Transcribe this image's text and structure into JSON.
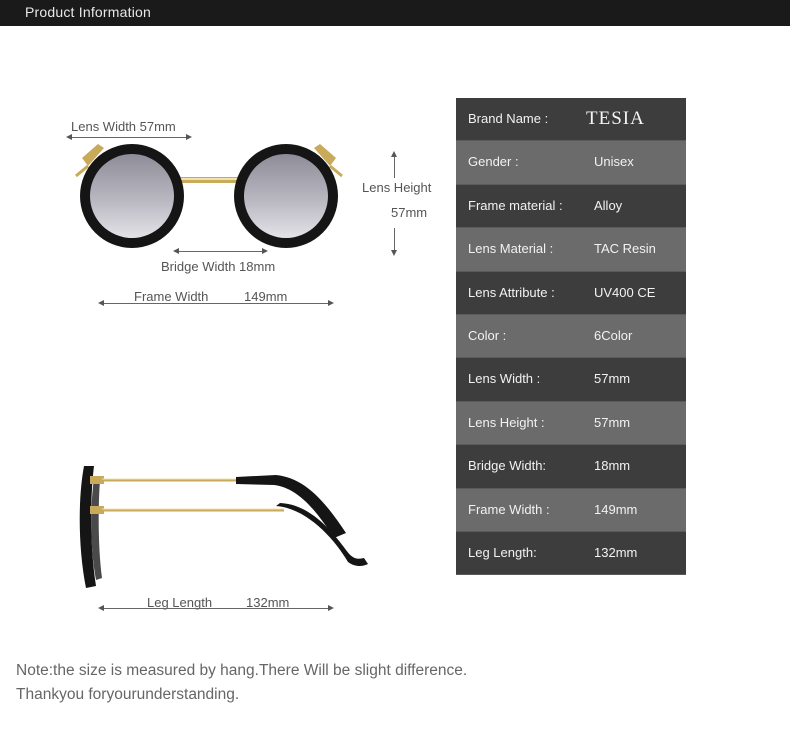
{
  "header": {
    "title": "Product Information"
  },
  "front_view": {
    "lens_width_label": "Lens  Width  57mm",
    "lens_height_label": "Lens Height",
    "lens_height_value": "57mm",
    "bridge_width_label": "Bridge  Width  18mm",
    "frame_width_label": "Frame    Width",
    "frame_width_value": "149mm"
  },
  "side_view": {
    "leg_length_label": "Leg Length",
    "leg_length_value": "132mm"
  },
  "specs": [
    {
      "key": "Brand  Name :",
      "value": "TESIA"
    },
    {
      "key": "Gender :",
      "value": "Unisex"
    },
    {
      "key": "Frame  material :",
      "value": "Alloy"
    },
    {
      "key": "Lens  Material :",
      "value": "TAC Resin"
    },
    {
      "key": "Lens  Attribute :",
      "value": "UV400 CE"
    },
    {
      "key": "Color :",
      "value": "6Color"
    },
    {
      "key": "Lens  Width :",
      "value": "57mm"
    },
    {
      "key": "Lens  Height :",
      "value": "57mm"
    },
    {
      "key": "Bridge   Width:",
      "value": "18mm"
    },
    {
      "key": "Frame   Width :",
      "value": "149mm"
    },
    {
      "key": "Leg   Length:",
      "value": "132mm"
    }
  ],
  "notes": {
    "line1": "Note:the size is measured by hang.There Will be slight difference.",
    "line2": "Thankyou foryourunderstanding."
  },
  "colors": {
    "header_bg": "#1a1a1a",
    "table_dark": "#3d3d3d",
    "table_light": "#6b6b6b",
    "frame_black": "#151515",
    "metal_gold": "#c9a95a"
  }
}
